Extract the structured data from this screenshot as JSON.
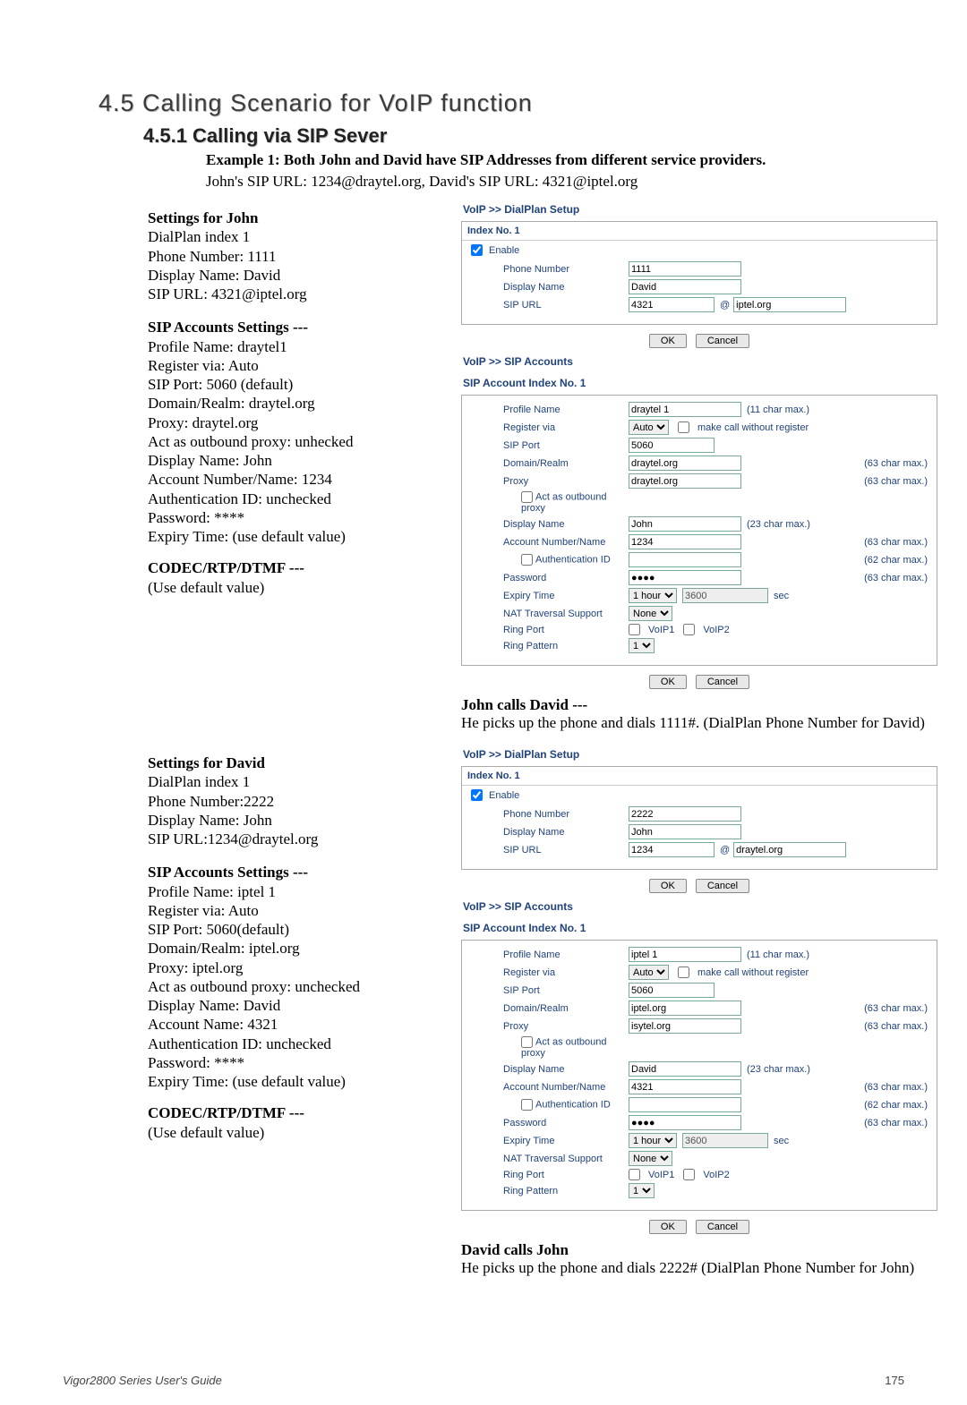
{
  "section_title": "4.5 Calling Scenario for VoIP function",
  "subsection_title": "4.5.1 Calling via SIP Sever",
  "example_heading": "Example 1: Both John and David have SIP Addresses from different service providers.",
  "example_line": "John's SIP URL: 1234@draytel.org, David's SIP URL: 4321@iptel.org",
  "john": {
    "settings_head": "Settings for John",
    "lines": [
      "DialPlan index 1",
      "Phone Number: 1111",
      "Display Name: David",
      "SIP URL: 4321@iptel.org"
    ],
    "sip_head": "SIP Accounts Settings ---",
    "sip_lines": [
      "Profile Name: draytel1",
      "Register via: Auto",
      "SIP Port: 5060 (default)",
      "Domain/Realm: draytel.org",
      "Proxy: draytel.org",
      "Act as outbound proxy: unhecked",
      "Display Name: John",
      "Account Number/Name: 1234",
      "Authentication ID: unchecked",
      "Password: ****",
      "Expiry Time: (use default value)"
    ],
    "codec_head": "CODEC/RTP/DTMF ---",
    "codec_line": "(Use default value)"
  },
  "david": {
    "settings_head": "Settings for David",
    "lines": [
      "DialPlan index 1",
      "Phone Number:2222",
      "Display Name: John",
      "SIP URL:1234@draytel.org"
    ],
    "sip_head": "SIP Accounts Settings ---",
    "sip_lines": [
      "Profile Name: iptel 1",
      "Register via: Auto",
      "SIP Port: 5060(default)",
      "Domain/Realm: iptel.org",
      "Proxy: iptel.org",
      "Act as outbound proxy: unchecked",
      "Display Name: David",
      "Account Name: 4321",
      "Authentication ID: unchecked",
      "Password: ****",
      "Expiry Time: (use default value)"
    ],
    "codec_head": "CODEC/RTP/DTMF ---",
    "codec_line": "(Use default value)"
  },
  "panel_labels": {
    "voip_dialplan_setup": "VoIP >> DialPlan Setup",
    "voip_sip_accounts": "VoIP >> SIP Accounts",
    "index_no1": "Index No. 1",
    "sip_account_index": "SIP Account Index No. 1",
    "enable": "Enable",
    "phone_number": "Phone Number",
    "display_name": "Display Name",
    "sip_url": "SIP URL",
    "profile_name": "Profile Name",
    "register_via": "Register via",
    "make_call": "make call without register",
    "sip_port": "SIP Port",
    "domain_realm": "Domain/Realm",
    "proxy": "Proxy",
    "act_outbound": "Act as outbound proxy",
    "account_number_name": "Account Number/Name",
    "auth_id": "Authentication ID",
    "password": "Password",
    "expiry_time": "Expiry Time",
    "nat_trav": "NAT Traversal Support",
    "ring_port": "Ring Port",
    "ring_pattern": "Ring Pattern",
    "voip1": "VoIP1",
    "voip2": "VoIP2",
    "ok": "OK",
    "cancel": "Cancel",
    "sec": "sec",
    "hint11": "(11 char max.)",
    "hint23": "(23 char max.)",
    "hint63": "(63 char max.)",
    "hint62": "(62 char max.)",
    "at": "@"
  },
  "dialplan_john": {
    "phone_number": "1111",
    "display_name": "David",
    "sip_url_user": "4321",
    "sip_url_domain": "iptel.org"
  },
  "dialplan_david": {
    "phone_number": "2222",
    "display_name": "John",
    "sip_url_user": "1234",
    "sip_url_domain": "draytel.org"
  },
  "sip_john": {
    "profile_name": "draytel 1",
    "register_via": "Auto",
    "sip_port": "5060",
    "domain_realm": "draytel.org",
    "proxy": "draytel.org",
    "display_name": "John",
    "account_number": "1234",
    "auth_id": "",
    "password": "●●●●",
    "expiry_sel": "1 hour",
    "expiry_val": "3600",
    "nat": "None",
    "ring_pattern": "1"
  },
  "sip_david": {
    "profile_name": "iptel 1",
    "register_via": "Auto",
    "sip_port": "5060",
    "domain_realm": "iptel.org",
    "proxy": "isytel.org",
    "display_name": "David",
    "account_number": "4321",
    "auth_id": "",
    "password": "●●●●",
    "expiry_sel": "1 hour",
    "expiry_val": "3600",
    "nat": "None",
    "ring_pattern": "1"
  },
  "call_john": {
    "head": "John calls David ---",
    "body": "He picks up the phone and dials 1111#. (DialPlan Phone Number for David)"
  },
  "call_david": {
    "head": "David calls John",
    "body": "He picks up the phone and dials 2222# (DialPlan Phone Number for John)"
  },
  "footer_left": "Vigor2800 Series User's Guide",
  "footer_right": "175"
}
